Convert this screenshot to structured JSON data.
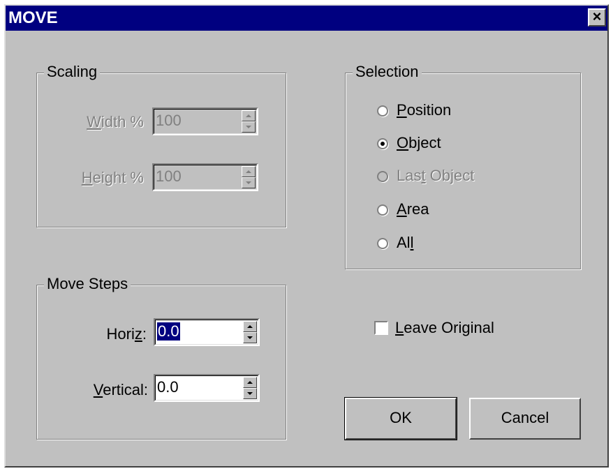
{
  "window": {
    "title": "MOVE",
    "close_glyph": "×"
  },
  "scaling": {
    "legend": "Scaling",
    "width": {
      "label_u": "W",
      "label_rest": "idth %",
      "value": "100"
    },
    "height": {
      "label_u": "H",
      "label_rest": "eight %",
      "value": "100"
    }
  },
  "move_steps": {
    "legend": "Move Steps",
    "horiz": {
      "label_pre": "Hori",
      "label_u": "z",
      "label_post": ":",
      "value": "0.0"
    },
    "vertical": {
      "label_u": "V",
      "label_rest": "ertical:",
      "value": "0.0"
    }
  },
  "selection": {
    "legend": "Selection",
    "options": [
      {
        "pre": "",
        "u": "P",
        "post": "osition",
        "checked": false,
        "enabled": true
      },
      {
        "pre": "",
        "u": "O",
        "post": "bject",
        "checked": true,
        "enabled": true
      },
      {
        "pre": "Las",
        "u": "t",
        "post": " Object",
        "checked": false,
        "enabled": false
      },
      {
        "pre": "",
        "u": "A",
        "post": "rea",
        "checked": false,
        "enabled": true
      },
      {
        "pre": "Al",
        "u": "l",
        "post": "",
        "checked": false,
        "enabled": true
      }
    ]
  },
  "leave_original": {
    "u": "L",
    "rest": "eave Original",
    "checked": false
  },
  "buttons": {
    "ok": "OK",
    "cancel": "Cancel"
  },
  "colors": {
    "face": "#c0c0c0",
    "titlebar": "#000080",
    "highlight": "#000080"
  }
}
